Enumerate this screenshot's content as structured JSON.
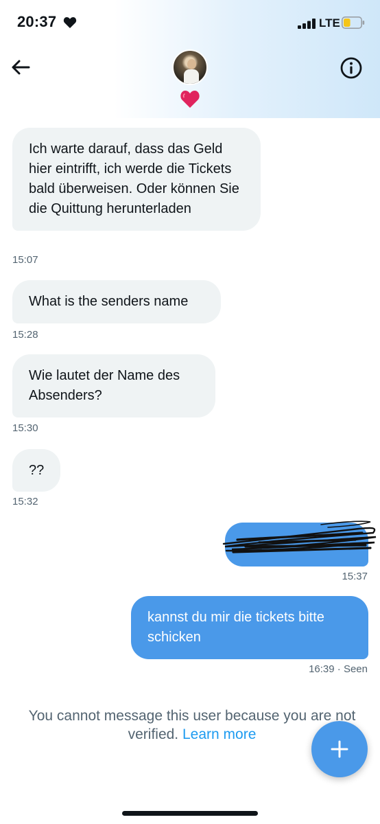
{
  "status_bar": {
    "time": "20:37",
    "network": "LTE",
    "battery_level": 0.4,
    "battery_color": "#f5c518"
  },
  "header": {
    "back_icon": "arrow-left-icon",
    "info_icon": "info-circle-icon",
    "reaction_icon": "red-heart-icon"
  },
  "messages": [
    {
      "direction": "in",
      "text": "Ich warte darauf, dass das Geld hier eintrifft, ich werde die Tickets bald überweisen. Oder können Sie die Quittung herunterladen",
      "time": "15:07"
    },
    {
      "direction": "in",
      "text": "What is the senders name",
      "time": "15:28"
    },
    {
      "direction": "in",
      "text": "Wie lautet der Name des Absenders?",
      "time": "15:30"
    },
    {
      "direction": "in",
      "text": "??",
      "time": "15:32"
    },
    {
      "direction": "out",
      "text": "",
      "redacted": true,
      "time": "15:37"
    },
    {
      "direction": "out",
      "text": "kannst du mir die tickets bitte schicken",
      "time": "16:39",
      "status": "· Seen"
    }
  ],
  "notice": {
    "text": "You cannot message this user because you are not verified.",
    "link": "Learn more"
  },
  "fab": {
    "icon": "plus-icon"
  },
  "colors": {
    "accent": "#1d9bf0",
    "outgoing_bubble": "#4a99e9",
    "incoming_bubble": "#eff3f4",
    "heart": "#e0245e"
  }
}
